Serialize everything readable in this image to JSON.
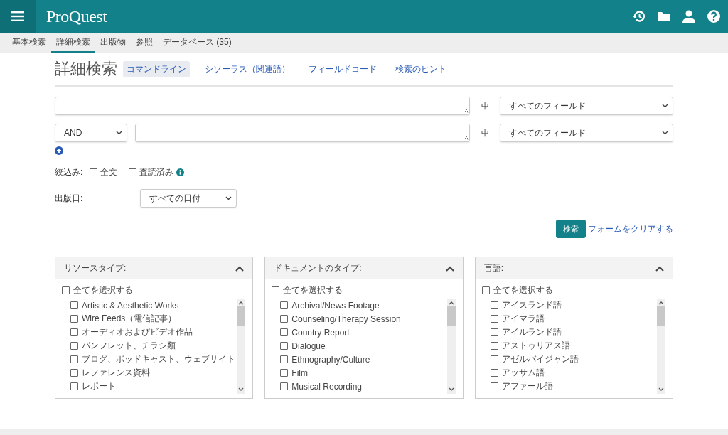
{
  "header": {
    "logo": "ProQuest"
  },
  "nav_tabs": [
    {
      "label": "基本検索",
      "selected": false
    },
    {
      "label": "詳細検索",
      "selected": true
    },
    {
      "label": "出版物",
      "selected": false
    },
    {
      "label": "参照",
      "selected": false
    },
    {
      "label": "データベース (35)",
      "selected": false
    }
  ],
  "page_title": "詳細検索",
  "sub_links": [
    {
      "label": "コマンドライン",
      "selected": true
    },
    {
      "label": "シソーラス（関連語）",
      "selected": false
    },
    {
      "label": "フィールドコード",
      "selected": false
    },
    {
      "label": "検索のヒント",
      "selected": false
    }
  ],
  "search_rows": [
    {
      "field_label": "中",
      "field": "すべてのフィールド"
    },
    {
      "operator": "AND",
      "field_label": "中",
      "field": "すべてのフィールド"
    }
  ],
  "limit": {
    "label": "絞込み:",
    "options": [
      {
        "label": "全文",
        "checked": false,
        "info": false
      },
      {
        "label": "査読済み",
        "checked": false,
        "info": true
      }
    ]
  },
  "publication_date": {
    "label": "出版日:",
    "value": "すべての日付"
  },
  "actions": {
    "search": "検索",
    "clear": "フォームをクリアする"
  },
  "facets": [
    {
      "title": "リソースタイプ:",
      "expanded": true,
      "select_all": {
        "label": "全てを選択する",
        "checked": false
      },
      "items": [
        {
          "label": "Artistic & Aesthetic Works",
          "checked": false
        },
        {
          "label": "Wire Feeds（電信記事）",
          "checked": false
        },
        {
          "label": "オーディオおよびビデオ作品",
          "checked": false
        },
        {
          "label": "パンフレット、チラシ類",
          "checked": false
        },
        {
          "label": "ブログ、ポッドキャスト、ウェブサイト",
          "checked": false
        },
        {
          "label": "レファレンス資料",
          "checked": false
        },
        {
          "label": "レポート",
          "checked": false
        }
      ]
    },
    {
      "title": "ドキュメントのタイプ:",
      "expanded": true,
      "select_all": {
        "label": "全てを選択する",
        "checked": false
      },
      "items": [
        {
          "label": "Archival/News Footage",
          "checked": false
        },
        {
          "label": "Counseling/Therapy Session",
          "checked": false
        },
        {
          "label": "Country Report",
          "checked": false
        },
        {
          "label": "Dialogue",
          "checked": false
        },
        {
          "label": "Ethnography/Culture",
          "checked": false
        },
        {
          "label": "Film",
          "checked": false
        },
        {
          "label": "Musical Recording",
          "checked": false
        }
      ]
    },
    {
      "title": "言語:",
      "expanded": true,
      "select_all": {
        "label": "全てを選択する",
        "checked": false
      },
      "items": [
        {
          "label": "アイスランド語",
          "checked": false
        },
        {
          "label": "アイマラ語",
          "checked": false
        },
        {
          "label": "アイルランド語",
          "checked": false
        },
        {
          "label": "アストゥリアス語",
          "checked": false
        },
        {
          "label": "アゼルバイジャン語",
          "checked": false
        },
        {
          "label": "アッサム語",
          "checked": false
        },
        {
          "label": "アファール語",
          "checked": false
        }
      ]
    }
  ]
}
